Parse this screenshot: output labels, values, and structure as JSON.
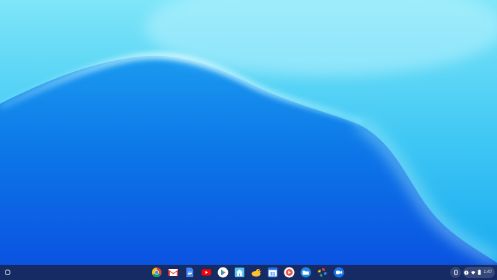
{
  "shelf": {
    "launcher_icon": "launcher-circle-icon",
    "apps": [
      {
        "name": "chrome",
        "icon": "chrome-icon"
      },
      {
        "name": "gmail",
        "icon": "gmail-icon"
      },
      {
        "name": "docs",
        "icon": "docs-icon"
      },
      {
        "name": "youtube",
        "icon": "youtube-icon"
      },
      {
        "name": "play-store",
        "icon": "play-store-icon"
      },
      {
        "name": "files-home",
        "icon": "home-app-icon"
      },
      {
        "name": "duck",
        "icon": "duck-app-icon"
      },
      {
        "name": "calendar",
        "icon": "calendar-icon",
        "label": "31"
      },
      {
        "name": "youtube-music",
        "icon": "music-app-icon"
      },
      {
        "name": "files",
        "icon": "files-folder-icon"
      },
      {
        "name": "photos",
        "icon": "photos-pinwheel-icon"
      },
      {
        "name": "meet",
        "icon": "video-camera-icon"
      }
    ],
    "status": {
      "time": "1:47",
      "icons": [
        "notification-icon",
        "wifi-icon",
        "battery-icon"
      ]
    }
  },
  "colors": {
    "wallpaper_top": "#7fe0f7",
    "wallpaper_mid": "#0a7fe6",
    "wallpaper_bottom": "#0b4fe0",
    "shelf": "#1a2040"
  }
}
